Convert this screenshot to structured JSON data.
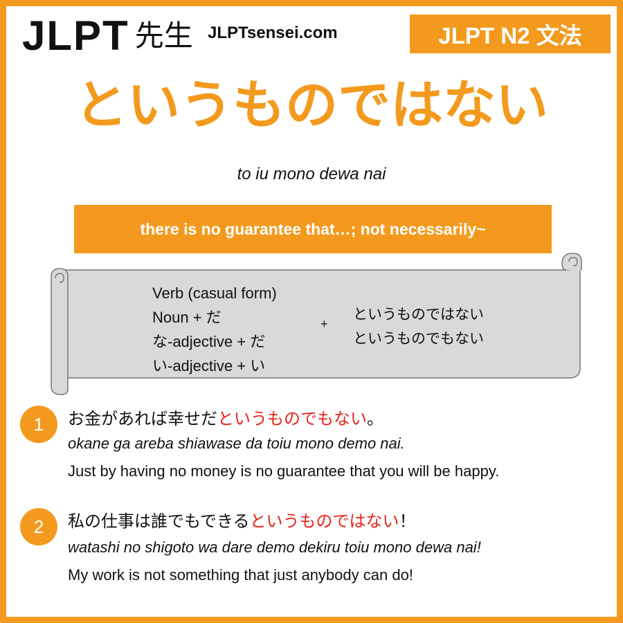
{
  "header": {
    "logo_text": "JLPT",
    "logo_kanji": "先生",
    "site_url": "JLPTsensei.com",
    "level_badge": "JLPT N2 文法"
  },
  "grammar": {
    "title": "というものではない",
    "romaji": "to iu mono dewa nai",
    "meaning": "there is no guarantee that…; not necessarily~"
  },
  "formation": {
    "left_lines": [
      "Verb (casual form)",
      "Noun + だ",
      "な-adjective + だ",
      "い-adjective + い"
    ],
    "plus": "+",
    "right_lines": [
      "というものではない",
      "というものでもない"
    ]
  },
  "examples": [
    {
      "number": "1",
      "jp_before": "お金があれば幸せだ",
      "jp_highlight": "というものでもない",
      "jp_after": "。",
      "romaji": "okane ga areba shiawase da toiu mono demo nai.",
      "english": "Just by having no money is no guarantee that you will be happy."
    },
    {
      "number": "2",
      "jp_before": "私の仕事は誰でもできる",
      "jp_highlight": "というものではない",
      "jp_after": "！",
      "romaji": "watashi no shigoto wa dare demo dekiru toiu mono dewa nai!",
      "english": "My work is not something that just anybody can do!"
    }
  ],
  "colors": {
    "accent": "#f39a1e",
    "highlight": "#e8231b",
    "scroll_fill": "#d9d9d9"
  }
}
